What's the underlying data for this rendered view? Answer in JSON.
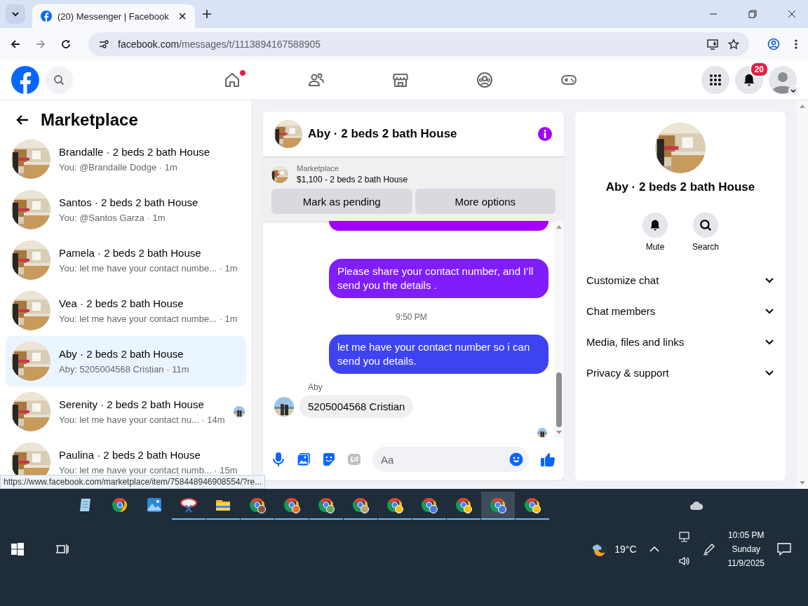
{
  "browser": {
    "tab_title": "(20) Messenger | Facebook",
    "url_host": "facebook.com",
    "url_path": "/messages/t/1113894167588905",
    "status_link": "https://www.facebook.com/marketplace/item/758448946908554/?re..."
  },
  "topbar": {
    "nav": [
      {
        "kind": "home",
        "dot": true
      },
      {
        "kind": "friends",
        "dot": false
      },
      {
        "kind": "marketplace",
        "dot": false
      },
      {
        "kind": "groups",
        "dot": false
      },
      {
        "kind": "gaming",
        "dot": false
      }
    ],
    "notifications_badge": "20"
  },
  "sidebar": {
    "title": "Marketplace",
    "conversations": [
      {
        "name": "Brandalle · 2 beds 2 bath House",
        "preview": "You: @Brandalle Dodge · 1m",
        "selected": false,
        "seen_avatar": false
      },
      {
        "name": "Santos · 2 beds 2 bath House",
        "preview": "You: @Santos Garza · 1m",
        "selected": false,
        "seen_avatar": false
      },
      {
        "name": "Pamela · 2 beds 2 bath House",
        "preview": "You: let me have your contact numbe... · 1m",
        "selected": false,
        "seen_avatar": false
      },
      {
        "name": "Vea · 2 beds 2 bath House",
        "preview": "You: let me have your contact numbe... · 1m",
        "selected": false,
        "seen_avatar": false
      },
      {
        "name": "Aby · 2 beds 2 bath House",
        "preview": "Aby: 5205004568 Cristian · 11m",
        "selected": true,
        "seen_avatar": false
      },
      {
        "name": "Serenity · 2 beds 2 bath House",
        "preview": "You: let me have your contact nu...  · 14m",
        "selected": false,
        "seen_avatar": true
      },
      {
        "name": "Paulina · 2 beds 2 bath House",
        "preview": "You: let me have your contact numb... · 15m",
        "selected": false,
        "seen_avatar": false
      }
    ]
  },
  "chat": {
    "title": "Aby · 2 beds 2 bath House",
    "listing": {
      "label": "Marketplace",
      "title": "$1,100 - 2 beds 2 bath House",
      "buttons": [
        "Mark as pending",
        "More options"
      ]
    },
    "messages": [
      {
        "kind": "cut",
        "color": "#a100ff"
      },
      {
        "kind": "outgoing",
        "color": "#7f1dfc",
        "text": "Please share your contact number, and I’ll send you the details ."
      },
      {
        "kind": "time",
        "text": "9:50 PM"
      },
      {
        "kind": "outgoing",
        "color": "#3e43f2",
        "text": "let me have your contact number so i can send you details."
      },
      {
        "kind": "incoming",
        "sender": "Aby",
        "text": "5205004568 Cristian"
      }
    ],
    "composer": {
      "placeholder": "Aa"
    }
  },
  "details": {
    "title": "Aby · 2 beds 2 bath House",
    "actions": [
      {
        "kind": "mute",
        "label": "Mute"
      },
      {
        "kind": "search",
        "label": "Search"
      }
    ],
    "sections": [
      {
        "label": "Customize chat",
        "expanded": false
      },
      {
        "label": "Chat members",
        "expanded": false
      },
      {
        "label": "Media, files and links",
        "expanded": false
      },
      {
        "label": "Privacy & support",
        "expanded": false
      }
    ]
  },
  "taskbar": {
    "apps": [
      {
        "kind": "notes",
        "running": false,
        "active": false
      },
      {
        "kind": "chrome",
        "running": false,
        "active": false
      },
      {
        "kind": "photos",
        "running": false,
        "active": false
      },
      {
        "kind": "snip",
        "running": true,
        "active": false
      },
      {
        "kind": "folder",
        "running": true,
        "active": false
      },
      {
        "kind": "profile",
        "running": true,
        "active": false,
        "color": "#8a5a3c"
      },
      {
        "kind": "profile",
        "running": true,
        "active": false,
        "color": "#e8702a"
      },
      {
        "kind": "profile",
        "running": true,
        "active": false,
        "color": "#6aa84f"
      },
      {
        "kind": "profile",
        "running": true,
        "active": false,
        "color": "#b8a070"
      },
      {
        "kind": "profile",
        "running": true,
        "active": false,
        "color": "#f4c20d"
      },
      {
        "kind": "profile",
        "running": true,
        "active": false,
        "color": "#4a78d8"
      },
      {
        "kind": "profile",
        "running": true,
        "active": false,
        "color": "#f4c20d"
      },
      {
        "kind": "profile",
        "running": true,
        "active": true,
        "color": "#4a78d8"
      },
      {
        "kind": "profile",
        "running": true,
        "active": false,
        "color": "#f4c20d"
      }
    ],
    "weather": "19°C",
    "time": "10:05 PM",
    "day": "Sunday",
    "date": "11/9/2025"
  }
}
